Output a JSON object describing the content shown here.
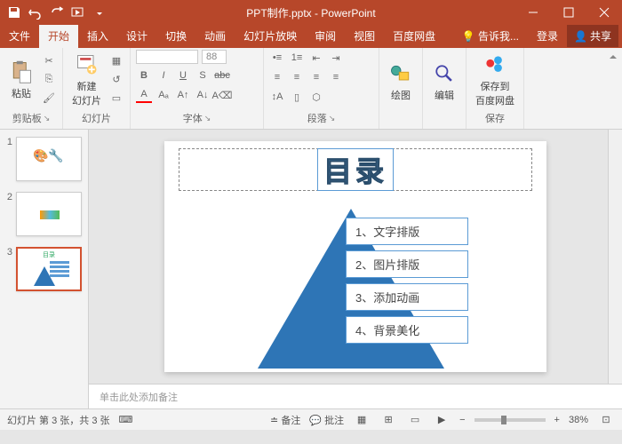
{
  "titlebar": {
    "title": "PPT制作.pptx - PowerPoint"
  },
  "tabs": {
    "file": "文件",
    "home": "开始",
    "insert": "插入",
    "design": "设计",
    "transitions": "切换",
    "animations": "动画",
    "slideshow": "幻灯片放映",
    "review": "审阅",
    "view": "视图",
    "baidu": "百度网盘",
    "tellme": "告诉我...",
    "signin": "登录",
    "share": "共享"
  },
  "ribbon": {
    "paste": "粘贴",
    "clipboard": "剪贴板",
    "newslide": "新建\n幻灯片",
    "slides": "幻灯片",
    "font": "字体",
    "fontsize": "88",
    "paragraph": "段落",
    "drawing": "绘图",
    "editing": "编辑",
    "saveto": "保存到\n百度网盘",
    "save": "保存"
  },
  "thumbs": [
    "1",
    "2",
    "3"
  ],
  "selected_thumb": 3,
  "slide": {
    "title": "目录",
    "items": [
      "1、文字排版",
      "2、图片排版",
      "3、添加动画",
      "4、背景美化"
    ]
  },
  "notes_placeholder": "单击此处添加备注",
  "statusbar": {
    "slideinfo": "幻灯片 第 3 张，共 3 张",
    "notes": "备注",
    "comments": "批注",
    "zoom": "38%"
  }
}
